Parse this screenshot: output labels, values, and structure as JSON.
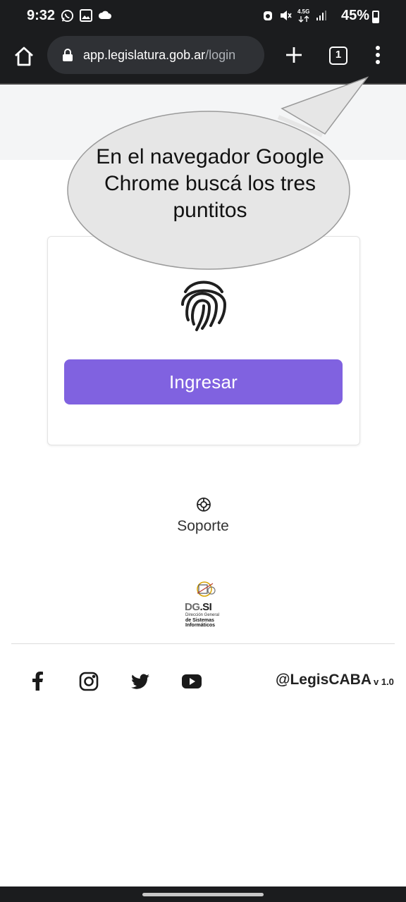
{
  "status_bar": {
    "time": "9:32",
    "battery_percent": "45%",
    "network_label": "4.5G",
    "left_icons": [
      "whatsapp-icon",
      "image-icon",
      "cloud-icon"
    ],
    "right_icons": [
      "alarm-icon",
      "mute-icon",
      "data-arrows-icon",
      "signal-icon",
      "battery-icon"
    ]
  },
  "browser": {
    "url_host": "app.legislatura.gob.ar",
    "url_path": "/login",
    "tab_count": "1"
  },
  "callout": {
    "text": "En el navegador Google Chrome buscá los tres puntitos"
  },
  "login": {
    "button_label": "Ingresar"
  },
  "support": {
    "label": "Soporte"
  },
  "logo": {
    "brand_dg": "DG",
    "brand_si": ".SI",
    "line1": "Dirección General",
    "line2": "de Sistemas",
    "line3": "Informáticos"
  },
  "footer": {
    "social": [
      "facebook-icon",
      "instagram-icon",
      "twitter-icon",
      "youtube-icon"
    ],
    "handle": "@LegisCABA",
    "version": "v 1.0"
  },
  "colors": {
    "primary": "#8062e0",
    "chrome_bg": "#1b1c1e",
    "callout_fill": "#e6e6e6"
  }
}
